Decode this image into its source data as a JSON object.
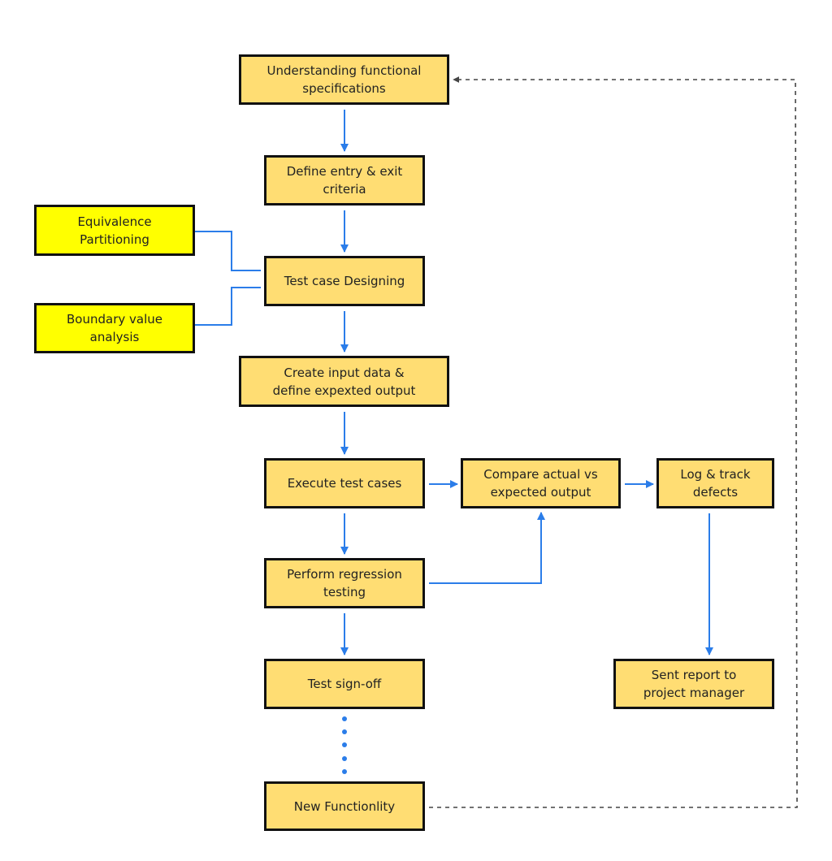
{
  "diagram": {
    "type": "flowchart",
    "title": "",
    "colors": {
      "process_fill": "#ffdd73",
      "technique_fill": "#ffff00",
      "border": "#111111",
      "flow_arrow": "#2b7de9",
      "loop_arrow": "#444444"
    },
    "nodes": {
      "understand": "Understanding functional\nspecifications",
      "define": "Define entry & exit\ncriteria",
      "equivalence": "Equivalence\nPartitioning",
      "boundary": "Boundary value\nanalysis",
      "design": "Test case Designing",
      "create": "Create input data &\ndefine expexted output",
      "execute": "Execute test cases",
      "compare": "Compare actual vs\nexpected output",
      "log": "Log & track\ndefects",
      "regression": "Perform regression\ntesting",
      "report": "Sent report to\nproject manager",
      "signoff": "Test sign-off",
      "newfunc": "New Functionlity"
    },
    "edges": [
      {
        "from": "understand",
        "to": "define",
        "style": "solid-arrow"
      },
      {
        "from": "define",
        "to": "design",
        "style": "solid-arrow"
      },
      {
        "from": "equivalence",
        "to": "design",
        "style": "solid-line"
      },
      {
        "from": "boundary",
        "to": "design",
        "style": "solid-line"
      },
      {
        "from": "design",
        "to": "create",
        "style": "solid-arrow"
      },
      {
        "from": "create",
        "to": "execute",
        "style": "solid-arrow"
      },
      {
        "from": "execute",
        "to": "compare",
        "style": "solid-arrow"
      },
      {
        "from": "compare",
        "to": "log",
        "style": "solid-arrow"
      },
      {
        "from": "execute",
        "to": "regression",
        "style": "solid-arrow"
      },
      {
        "from": "regression",
        "to": "compare",
        "style": "solid-arrow"
      },
      {
        "from": "log",
        "to": "report",
        "style": "solid-arrow"
      },
      {
        "from": "regression",
        "to": "signoff",
        "style": "solid-arrow"
      },
      {
        "from": "signoff",
        "to": "newfunc",
        "style": "dotted"
      },
      {
        "from": "newfunc",
        "to": "understand",
        "style": "dashed-arrow"
      }
    ]
  }
}
